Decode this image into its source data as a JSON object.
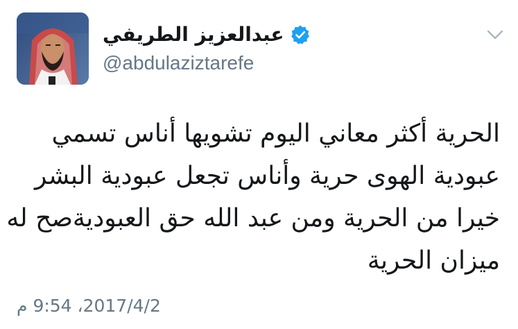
{
  "author": {
    "display_name": "عبدالعزيز الطريفي",
    "handle": "@abdulaziztarefe",
    "verified": true,
    "avatar_icon": "profile-photo",
    "verified_icon": "verified-badge-icon"
  },
  "menu": {
    "icon": "chevron-down-icon"
  },
  "tweet": {
    "lines": [
      "الحرية أكثر معاني اليوم تشويها أناس تسمي",
      "عبودية الهوى حرية وأناس تجعل عبودية البشر",
      "خيرا من الحرية ومن عبد الله حق العبوديةصح له",
      "ميزان الحرية"
    ],
    "timestamp": "2017/4/2، 9:54 م"
  },
  "colors": {
    "text": "#14171a",
    "secondary": "#657786",
    "verified": "#1da1f2",
    "chevron": "#aab8c2"
  }
}
